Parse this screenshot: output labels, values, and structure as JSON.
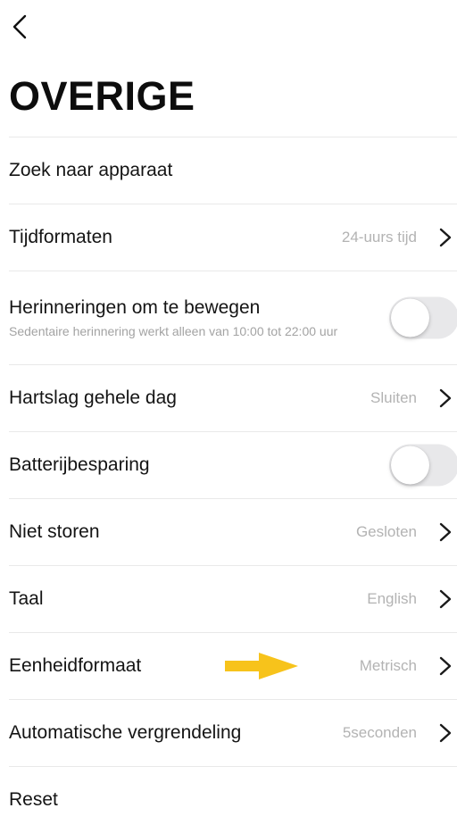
{
  "header": {
    "back_icon": "chevron-left-icon",
    "title": "OVERIGE"
  },
  "settings": {
    "find_device": {
      "label": "Zoek naar apparaat"
    },
    "time_format": {
      "label": "Tijdformaten",
      "value": "24-uurs tijd"
    },
    "move_reminder": {
      "label": "Herinneringen om te bewegen",
      "sublabel": "Sedentaire herinnering werkt alleen van 10:00 tot 22:00 uur",
      "enabled": false
    },
    "heart_rate": {
      "label": "Hartslag gehele dag",
      "value": "Sluiten"
    },
    "battery_saving": {
      "label": "Batterijbesparing",
      "enabled": false
    },
    "do_not_disturb": {
      "label": "Niet storen",
      "value": "Gesloten"
    },
    "language": {
      "label": "Taal",
      "value": "English"
    },
    "unit_format": {
      "label": "Eenheidformaat",
      "value": "Metrisch"
    },
    "auto_lock": {
      "label": "Automatische vergrendeling",
      "value": "5seconden"
    },
    "reset": {
      "label": "Reset"
    }
  },
  "annotation": {
    "icon": "arrow-right-icon",
    "color": "#F7C31B"
  },
  "colors": {
    "toggle_off": "#e8e8ea",
    "value_text": "#b3b3b3",
    "divider": "#e9e9e9"
  }
}
